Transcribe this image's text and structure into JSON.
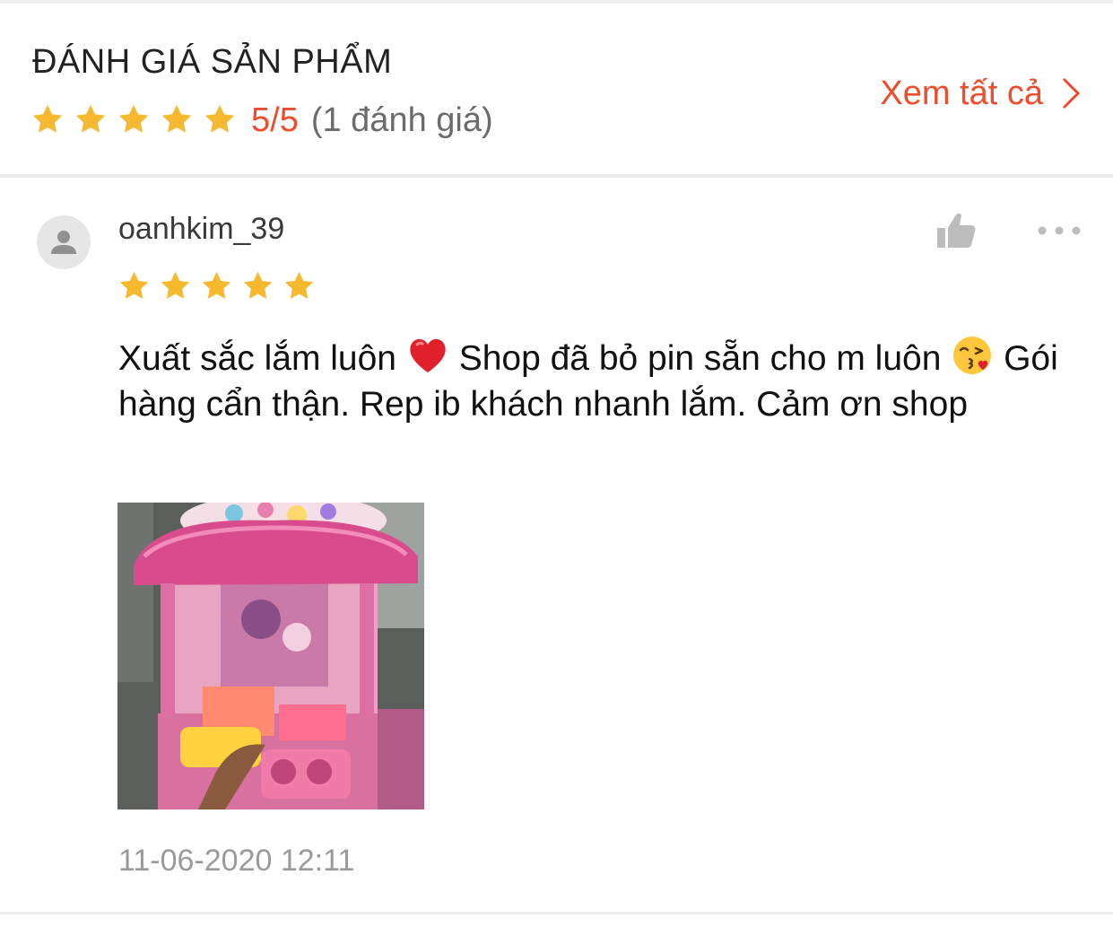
{
  "section": {
    "title": "ĐÁNH GIÁ SẢN PHẨM",
    "rating_score": "5/5",
    "rating_count": "(1 đánh giá)",
    "see_all_label": "Xem tất cả",
    "star_color": "#f6b82c",
    "accent_color": "#ee4d2d"
  },
  "review": {
    "username": "oanhkim_39",
    "stars": 5,
    "text_part1": "Xuất sắc lắm luôn",
    "text_part2": " Shop đã bỏ pin sẵn cho m luôn ",
    "text_part3": "  Gói hàng cẩn thận. Rep ib khách nhanh lắm. Cảm ơn shop",
    "emoji_1": "red-heart-icon",
    "emoji_2": "kissing-face-icon",
    "date": "11-06-2020 12:11"
  }
}
